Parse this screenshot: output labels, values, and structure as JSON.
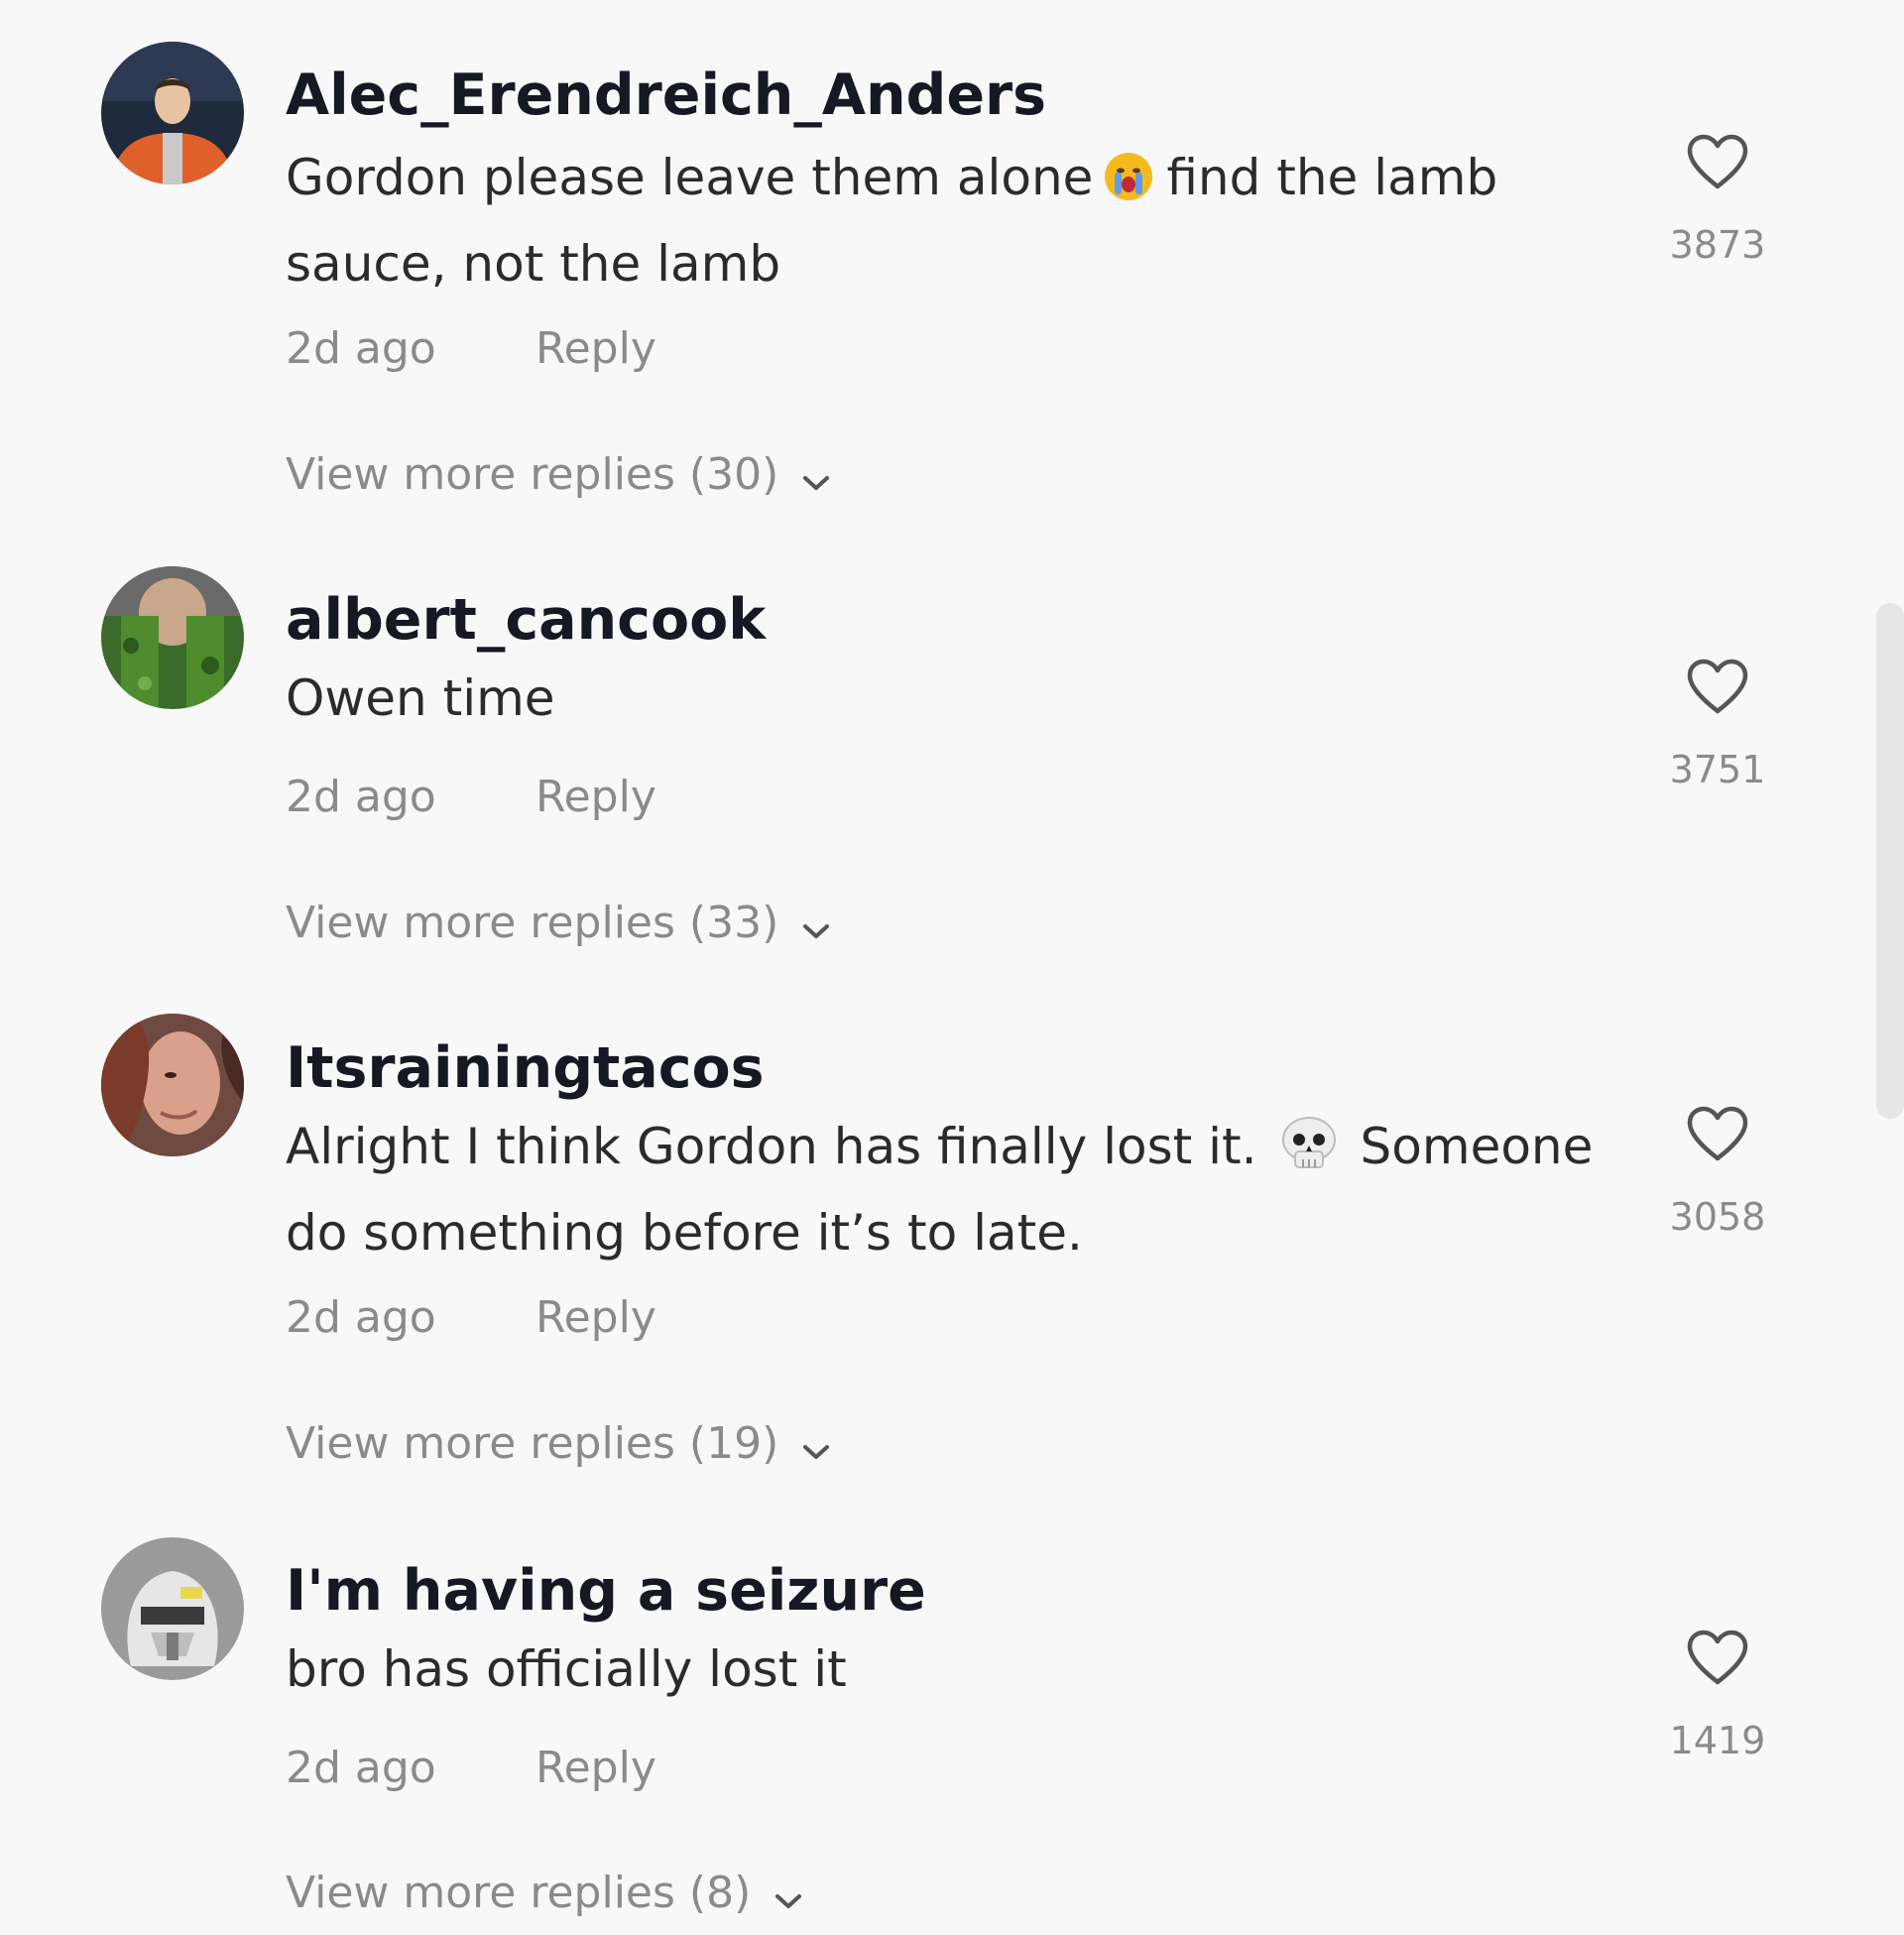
{
  "comments": [
    {
      "username": "Alec_Erendreich_Anders",
      "text_part1": "Gordon please leave them alone",
      "text_emoji": "loudly-crying-face-emoji",
      "text_part2": "find the lamb sauce, not the lamb",
      "time": "2d ago",
      "reply_label": "Reply",
      "likes": "3873",
      "more_replies": "View more replies (30)"
    },
    {
      "username": "albert_cancook",
      "text": "Owen time",
      "time": "2d ago",
      "reply_label": "Reply",
      "likes": "3751",
      "more_replies": "View more replies (33)"
    },
    {
      "username": "Itsrainingtacos",
      "text_part1": "Alright I think Gordon has finally lost it.",
      "text_emoji": "skull-emoji",
      "text_part2": "Someone do something before it’s to late.",
      "time": "2d ago",
      "reply_label": "Reply",
      "likes": "3058",
      "more_replies": "View more replies (19)"
    },
    {
      "username": "I'm having a seizure",
      "text": "bro has officially lost it",
      "time": "2d ago",
      "reply_label": "Reply",
      "likes": "1419",
      "more_replies": "View more replies (8)"
    }
  ],
  "icons": {
    "like": "heart-outline-icon",
    "expand": "chevron-down-icon"
  },
  "colors": {
    "background": "#f8f8f8",
    "username": "#161823",
    "text": "#2b2b2b",
    "meta": "#8a8a8a"
  }
}
